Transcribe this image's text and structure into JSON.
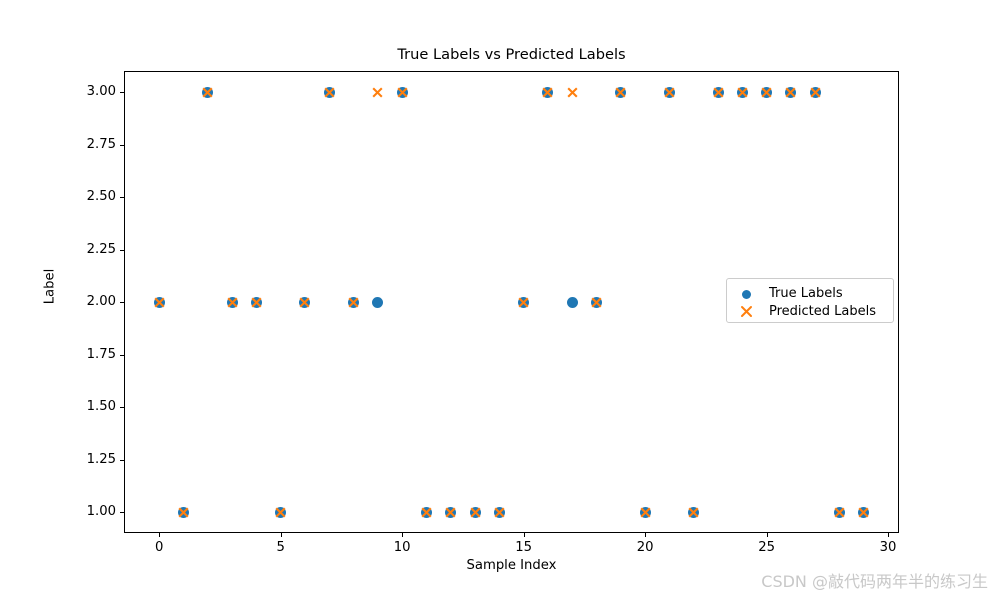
{
  "chart_data": {
    "type": "scatter",
    "title": "True Labels vs Predicted Labels",
    "xlabel": "Sample Index",
    "ylabel": "Label",
    "xlim": [
      -1.45,
      30.45
    ],
    "ylim": [
      0.9,
      3.1
    ],
    "grid": false,
    "legend_position": "center right",
    "xticks": [
      "0",
      "5",
      "10",
      "15",
      "20",
      "25",
      "30"
    ],
    "xtick_values": [
      0,
      5,
      10,
      15,
      20,
      25,
      30
    ],
    "yticks": [
      "1.00",
      "1.25",
      "1.50",
      "1.75",
      "2.00",
      "2.25",
      "2.50",
      "2.75",
      "3.00"
    ],
    "ytick_values": [
      1.0,
      1.25,
      1.5,
      1.75,
      2.0,
      2.25,
      2.5,
      2.75,
      3.0
    ],
    "x": [
      0,
      1,
      2,
      3,
      4,
      5,
      6,
      7,
      8,
      9,
      10,
      11,
      12,
      13,
      14,
      15,
      16,
      17,
      18,
      19,
      20,
      21,
      22,
      23,
      24,
      25,
      26,
      27,
      28,
      29
    ],
    "series": [
      {
        "name": "True Labels",
        "marker": "circle",
        "color": "#1f77b4",
        "values": [
          2,
          1,
          3,
          2,
          2,
          1,
          2,
          3,
          2,
          2,
          3,
          1,
          1,
          1,
          1,
          2,
          3,
          2,
          2,
          3,
          1,
          3,
          1,
          3,
          3,
          3,
          3,
          3,
          1,
          1
        ]
      },
      {
        "name": "Predicted Labels",
        "marker": "x",
        "color": "#ff7f0e",
        "values": [
          2,
          1,
          3,
          2,
          2,
          1,
          2,
          3,
          2,
          3,
          3,
          1,
          1,
          1,
          1,
          2,
          3,
          3,
          2,
          3,
          1,
          3,
          1,
          3,
          3,
          3,
          3,
          3,
          1,
          1
        ]
      }
    ]
  },
  "legend": {
    "entries": [
      {
        "label": "True Labels",
        "icon": "filled-circle-marker"
      },
      {
        "label": "Predicted Labels",
        "icon": "cross-marker"
      }
    ]
  },
  "watermark": {
    "text": "CSDN @敲代码两年半的练习生"
  },
  "colors": {
    "true_labels": "#1f77b4",
    "predicted_labels": "#ff7f0e",
    "axis": "#000000",
    "background": "#ffffff",
    "watermark": "#c8c8c8"
  }
}
